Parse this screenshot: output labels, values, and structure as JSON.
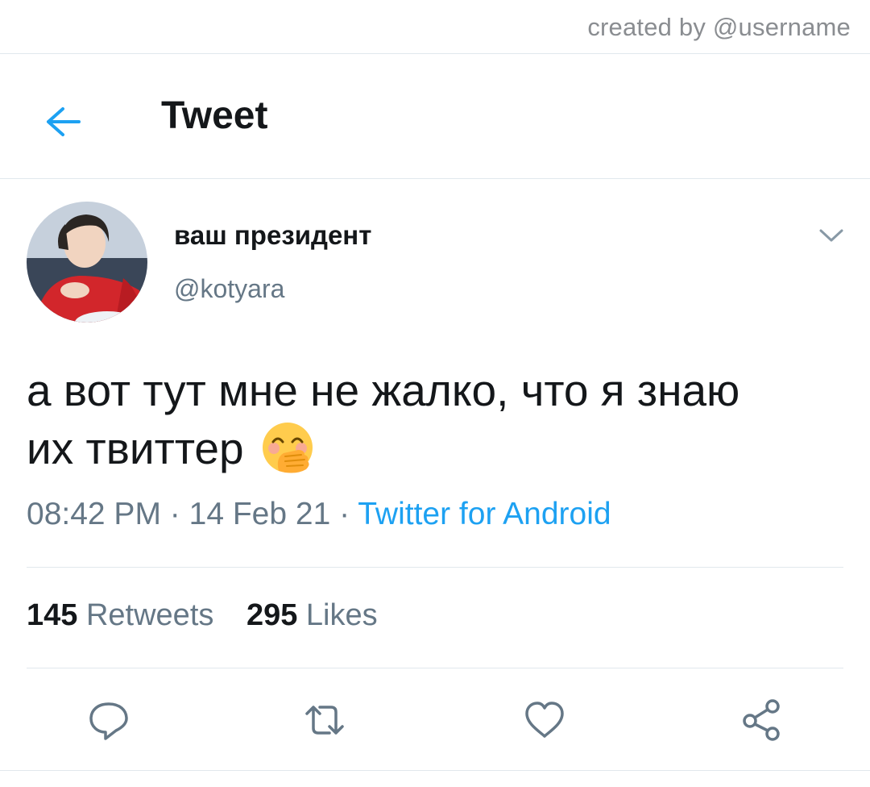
{
  "credit": "created by @username",
  "header": {
    "title": "Tweet",
    "back_icon": "arrow-left-icon",
    "accent": "#1da1f2"
  },
  "user": {
    "name": "ваш президент",
    "handle": "@kotyara",
    "avatar": "profile-photo"
  },
  "tweet": {
    "text_line1": "а вот тут мне не жалко, что я знаю",
    "text_line2": "их твиттер",
    "emoji": "face-with-hand-over-mouth",
    "time": "08:42 PM",
    "date": "14 Feb 21",
    "separator": "·",
    "source": "Twitter for Android"
  },
  "stats": {
    "retweets_count": "145",
    "retweets_label": "Retweets",
    "likes_count": "295",
    "likes_label": "Likes"
  },
  "actions": [
    "reply-icon",
    "retweet-icon",
    "like-icon",
    "share-icon"
  ],
  "colors": {
    "text": "#14171a",
    "secondary": "#657786",
    "link": "#1da1f2",
    "divider": "#e1e8ed"
  }
}
